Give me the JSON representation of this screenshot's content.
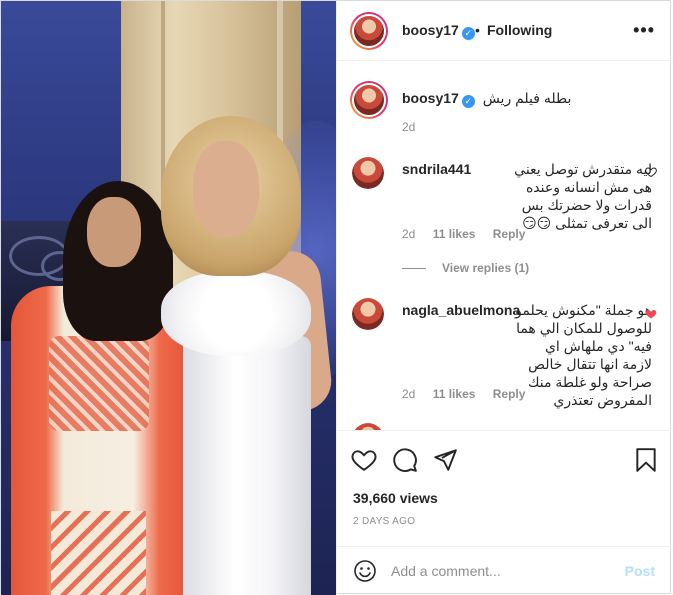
{
  "post": {
    "username": "boosy17",
    "separator": "•",
    "follow_status": "Following",
    "more_label": "•••"
  },
  "caption": {
    "username": "boosy17",
    "text": "بطله فيلم ريش",
    "time": "2d"
  },
  "comments": [
    {
      "username": "sndrila441",
      "text": "ليه متقدرش توصل يعني هى مش انسانه وعنده قدرات ولا حضرتك بس الى تعرفى تمثلى 😏😏",
      "time": "2d",
      "likes": "11 likes",
      "reply": "Reply",
      "liked": false,
      "view_replies": "View replies (1)"
    },
    {
      "username": "nagla_abuelmona",
      "text": "هو جملة \"مكنوش يحلمو للوصول للمكان الي هما فيه\" دي ملهاش اي لازمة انها تتقال خالص صراحة ولو غلطة منك المفروض تعتذري",
      "time": "2d",
      "likes": "11 likes",
      "reply": "Reply",
      "liked": true
    }
  ],
  "stats": {
    "views": "39,660 views",
    "date": "2 DAYS AGO"
  },
  "add_comment": {
    "placeholder": "Add a comment...",
    "post_label": "Post"
  },
  "colors": {
    "verified": "#3897f0",
    "liked_heart": "#ed4956",
    "post_disabled": "#b2dffc",
    "meta_gray": "#8e8e8e"
  },
  "icons": [
    "more-options-icon",
    "verified-icon",
    "heart-icon",
    "comment-icon",
    "share-icon",
    "bookmark-icon",
    "emoji-icon"
  ]
}
